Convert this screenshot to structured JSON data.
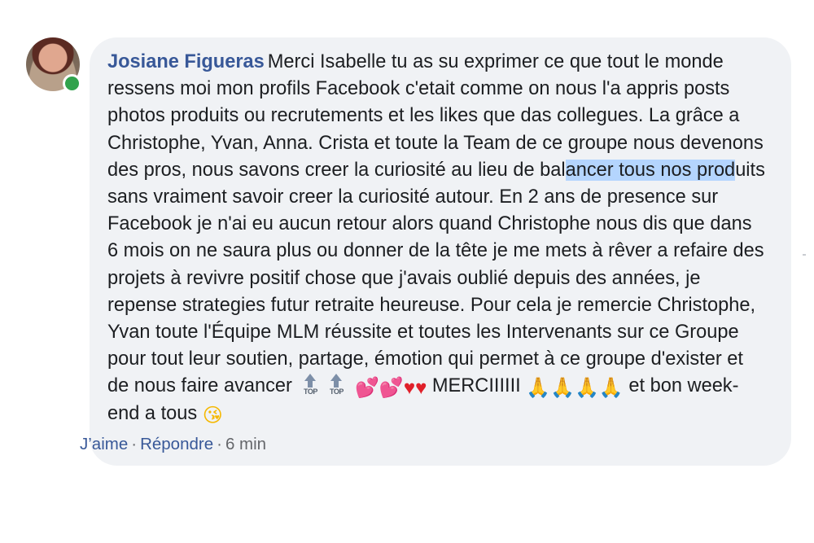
{
  "comment": {
    "author": "Josiane Figueras",
    "text_before_highlight": "Merci Isabelle tu as su exprimer ce que tout le monde ressens moi mon profils Facebook c'etait comme on nous l'a appris posts photos produits ou recrutements et les likes que das collegues. La grâce a Christophe, Yvan, Anna. Crista et toute la Team de ce groupe nous devenons des pros, nous savons creer la curiosité au lieu de bal",
    "highlighted_text": "ancer tous nos prod",
    "text_after_highlight": "uits sans vraiment savoir creer la curiosité autour. En 2 ans de presence sur Facebook je n'ai eu aucun retour alors quand Christophe nous dis que dans 6 mois on ne saura plus ou donner de la tête je me mets à rêver a refaire des projets à revivre positif chose que j'avais oublié depuis des années, je repense strategies futur retraite heureuse. Pour cela je remercie Christophe, Yvan toute l'Équipe MLM réussite et toutes les Intervenants sur ce Groupe pour tout leur soutien, partage, émotion qui permet à ce groupe d'exister et de nous faire avancer",
    "top_emoji_label": "TOP",
    "merci_text": "MERCIIIIII",
    "closing_text": "et bon week-end a tous",
    "online_status_color": "#31a24c",
    "emojis": {
      "top_arrow": "top-arrow-icon",
      "two_hearts": "💕",
      "red_heart": "♥",
      "folded_hands": "🙏",
      "kiss_face": "😘"
    }
  },
  "actions": {
    "like_label": "J’aime",
    "reply_label": "Répondre",
    "separator": "·",
    "timestamp": "6 min"
  },
  "colors": {
    "author": "#385898",
    "bubble_bg": "#f0f2f5",
    "text": "#1c1e21",
    "highlight": "#b4d5fe",
    "meta": "#65676b"
  }
}
